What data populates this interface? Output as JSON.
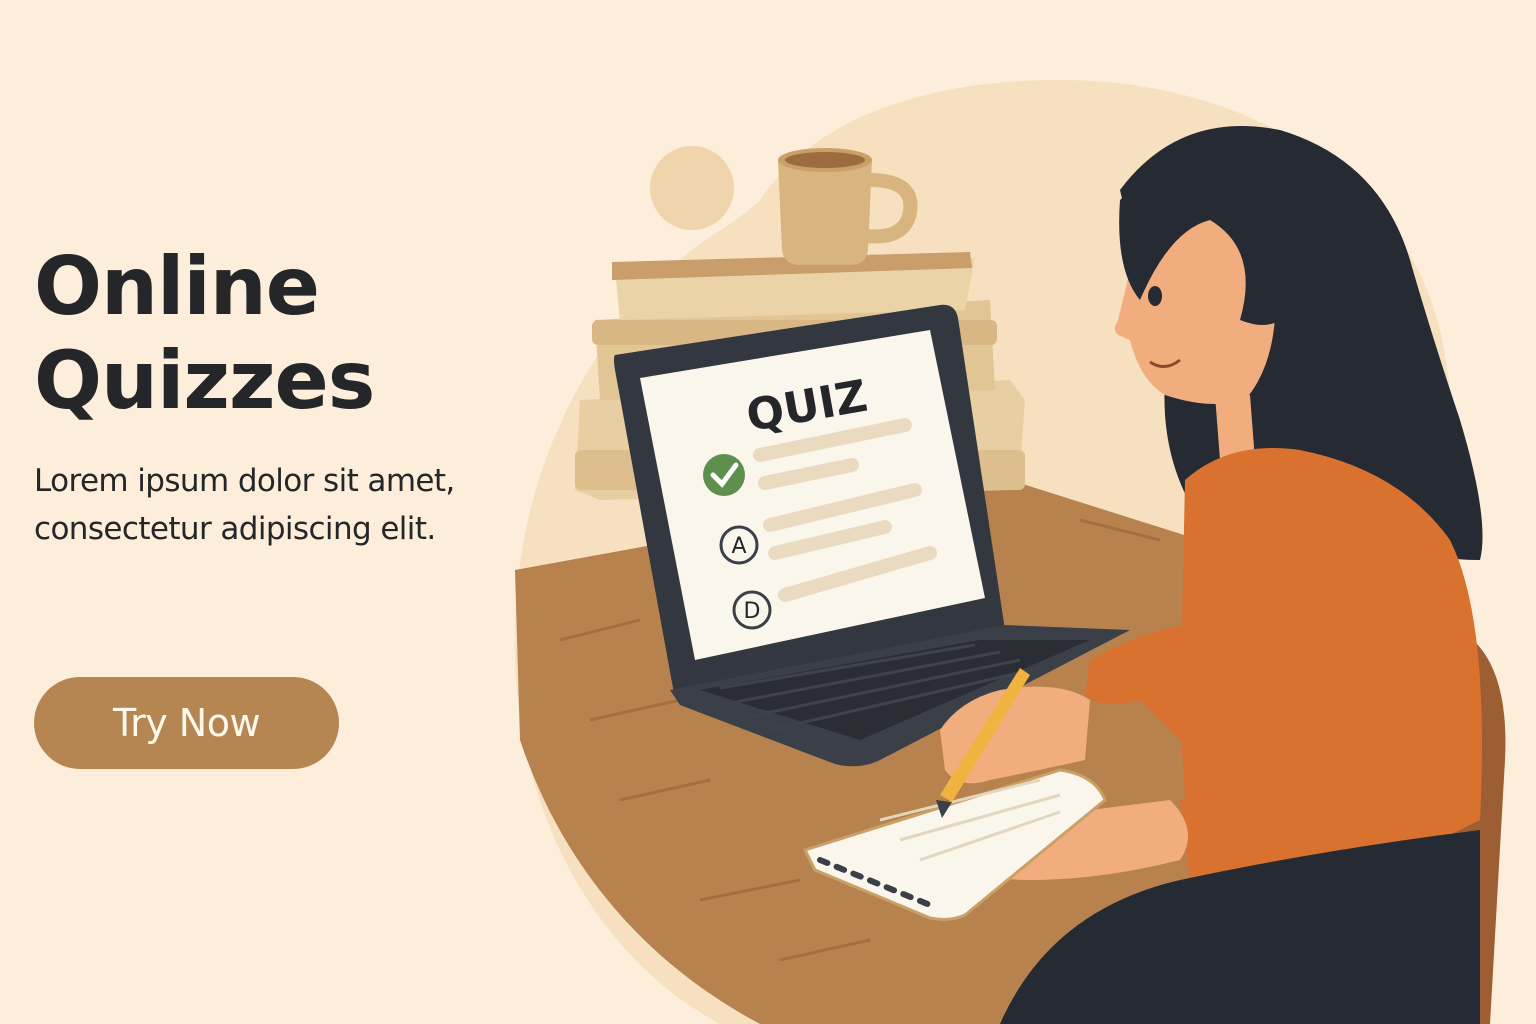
{
  "hero": {
    "title_line1": "Online",
    "title_line2": "Quizzes",
    "subtitle_line1": "Lorem ipsum dolor sit amet,",
    "subtitle_line2": "consectetur adipiscing elit.",
    "cta_label": "Try Now"
  },
  "laptop_screen": {
    "quiz_title": "QUIZ",
    "options": [
      {
        "marker": "check-icon",
        "state": "correct"
      },
      {
        "marker": "A"
      },
      {
        "marker": "D"
      }
    ]
  },
  "colors": {
    "background": "#FCEEDB",
    "accent": "#B68652",
    "text": "#25262A",
    "sweater": "#D9712F",
    "check": "#5E8F4E"
  },
  "icons": [
    "check-icon",
    "coffee-mug-icon",
    "pencil-icon",
    "notebook-icon"
  ]
}
